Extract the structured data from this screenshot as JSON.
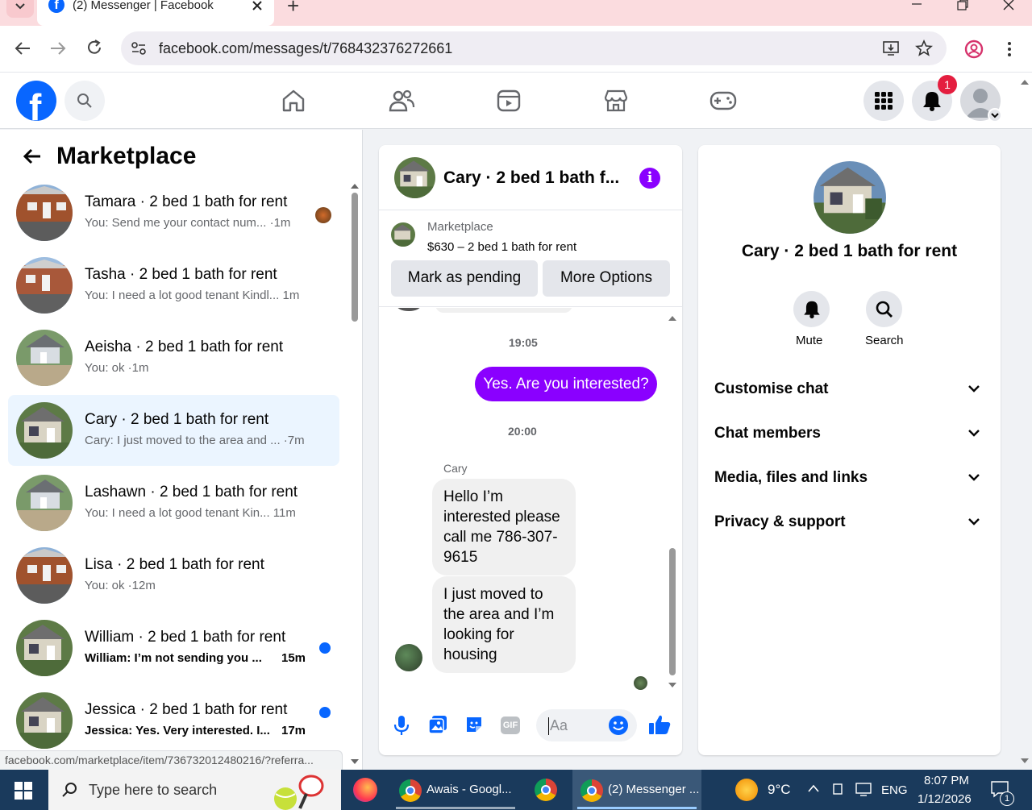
{
  "browser": {
    "tab_title": "(2) Messenger | Facebook",
    "new_tab": "+",
    "url": "facebook.com/messages/t/768432376272661",
    "status_url": "facebook.com/marketplace/item/736732012480216/?referra..."
  },
  "fb_header": {
    "notification_badge": "1"
  },
  "left": {
    "back_title": "Marketplace",
    "conversations": [
      {
        "name": "Tamara · 2 bed 1 bath for rent",
        "preview": "You: Send me your contact num... ·1m",
        "unread": false
      },
      {
        "name": "Tasha · 2 bed 1 bath for rent",
        "preview": "You: I need a lot good tenant Kindl...  1m",
        "unread": false
      },
      {
        "name": "Aeisha · 2 bed 1 bath for rent",
        "preview": "You: ok ·1m",
        "unread": false
      },
      {
        "name": "Cary · 2 bed 1 bath for rent",
        "preview": "Cary: I just moved to the area and ... ·7m",
        "unread": false,
        "selected": true
      },
      {
        "name": "Lashawn · 2 bed 1 bath for rent",
        "preview": "You: I need a lot good tenant Kin...   11m",
        "unread": false
      },
      {
        "name": "Lisa · 2 bed 1 bath for rent",
        "preview": "You: ok ·12m",
        "unread": false
      },
      {
        "name": "William · 2 bed 1 bath for rent",
        "preview": "William: I’m not sending you ...",
        "time": "15m",
        "unread": true
      },
      {
        "name": "Jessica · 2 bed 1 bath for rent",
        "preview": "Jessica: Yes. Very interested. I...",
        "time": "17m",
        "unread": true
      }
    ]
  },
  "chat": {
    "title": "Cary · 2 bed 1 bath f...",
    "listing_source": "Marketplace",
    "listing_title": "$630 – 2 bed 1 bath for rent",
    "mark_pending": "Mark as pending",
    "more_options": "More Options",
    "time1": "19:05",
    "my_message": "Yes. Are you interested?",
    "time2": "20:00",
    "sender_name": "Cary",
    "msg1": "Hello I’m interested please call me 786-307-9615",
    "msg2": "I just moved to the area and I’m looking for housing",
    "composer_placeholder": "Aa",
    "gif_label": "GIF"
  },
  "info": {
    "title": "Cary · 2 bed 1 bath for rent",
    "mute": "Mute",
    "search": "Search",
    "sections": [
      "Customise chat",
      "Chat members",
      "Media, files and links",
      "Privacy & support"
    ]
  },
  "taskbar": {
    "search_placeholder": "Type here to search",
    "app1": "Awais - Googl...",
    "app2": "(2) Messenger ...",
    "weather": "9°C",
    "lang": "ENG",
    "time": "8:07 PM",
    "date": "1/12/2026",
    "notif_count": "1"
  },
  "colors": {
    "fb_blue": "#0866ff",
    "messenger_purple": "#8a00ff",
    "selected_row": "#ebf5ff",
    "unread_dot": "#0866ff"
  }
}
